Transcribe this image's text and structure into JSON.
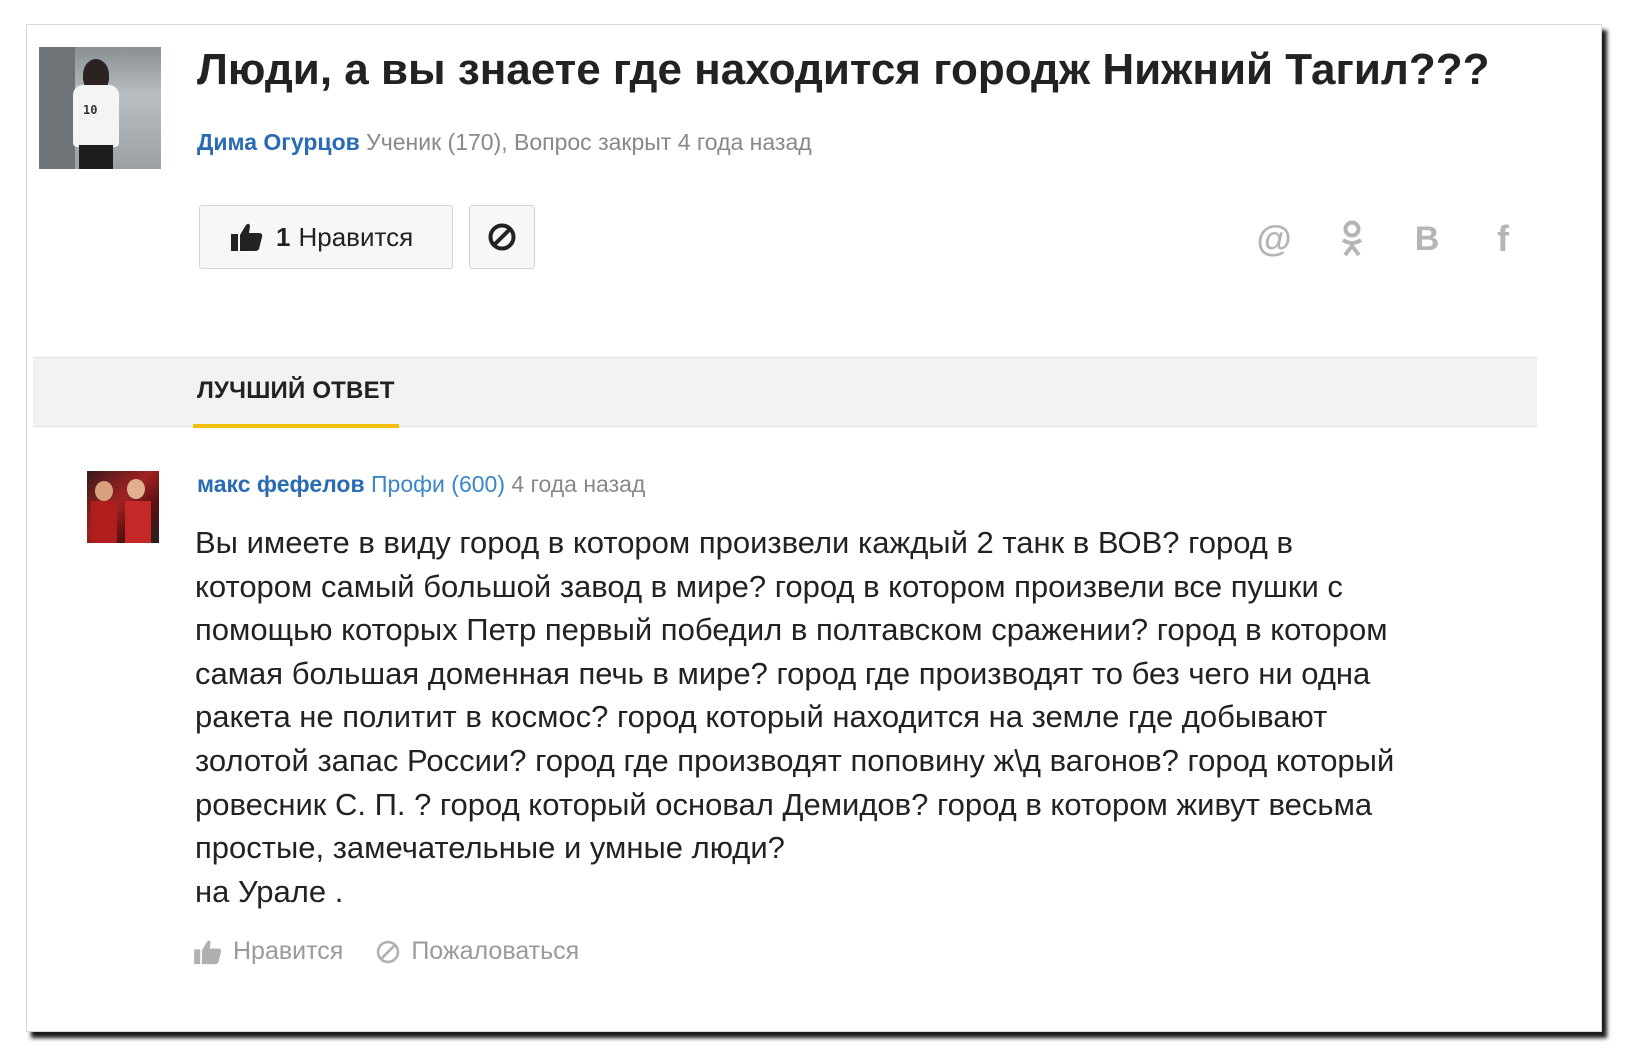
{
  "question": {
    "title": "Люди, а вы знаете где находится городж Нижний Тагил???",
    "author": "Дима Огурцов",
    "meta": "Ученик (170), Вопрос закрыт 4 года назад",
    "avatar_number": "10",
    "like_count": "1",
    "like_label": "Нравится"
  },
  "share": {
    "at_glyph": "@",
    "vk_glyph": "В",
    "fb_glyph": "f"
  },
  "best_answer": {
    "tab_label": "ЛУЧШИЙ ОТВЕТ",
    "author": "макс фефелов",
    "rank": "Профи (600)",
    "time": "4 года назад",
    "lines": [
      "Вы имеете в виду город в котором произвели каждый 2 танк в ВОВ? город в",
      "котором самый большой завод в мире? город в котором произвели все пушки с",
      "помощью которых Петр первый победил в полтавском сражении? город в котором",
      "самая большая доменная печь в мире? город где производят то без чего ни одна",
      "ракета не политит в космос? город который находится на земле где добывают",
      "золотой запас России? город где производят поповину ж\\д вагонов? город который",
      "ровесник С. П. ? город который основал Демидов? город в котором живут весьма",
      "простые, замечательные и умные люди?",
      "на Урале ."
    ],
    "like_label": "Нравится",
    "report_label": "Пожаловаться"
  },
  "colors": {
    "link": "#2a6bb5",
    "accent": "#f2c10b",
    "muted": "#9a9a9a"
  }
}
